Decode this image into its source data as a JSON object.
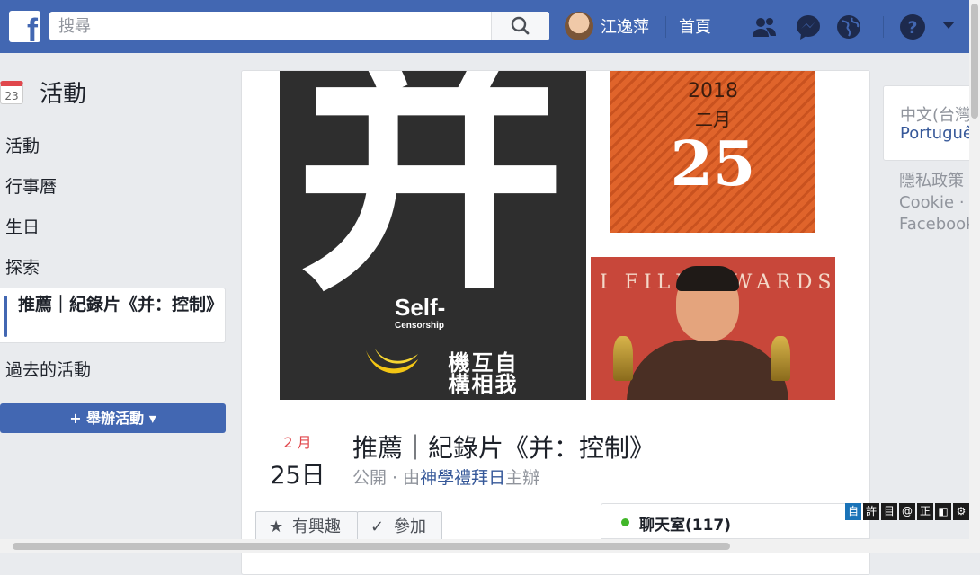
{
  "topbar": {
    "logo": "f",
    "search_placeholder": "搜尋",
    "username": "江逸萍",
    "home": "首頁",
    "icons": [
      "friends-icon",
      "messenger-icon",
      "notifications-globe-icon",
      "help-icon",
      "account-menu-caret-icon"
    ],
    "color": "#4267b2"
  },
  "nav": {
    "calendar_day": "23",
    "title": "活動",
    "items": [
      "活動",
      "行事曆",
      "生日",
      "探索"
    ],
    "active": "推薦｜紀錄片《并：控制》",
    "past": "過去的活動",
    "create_plus": "+",
    "create_label": "舉辦活動",
    "create_caret": "▾"
  },
  "cover": {
    "poster_char": "并",
    "poster_en_1": "Self-",
    "poster_en_2": "Censorship",
    "poster_v1": "自我",
    "poster_v2": "互相",
    "poster_v3": "機構",
    "poster_date_year": "2018",
    "poster_date_month": "二月",
    "poster_date_day": "25",
    "award_text": "I FILM AWARDS"
  },
  "event": {
    "month": "2 月",
    "day": "25日",
    "title": "推薦｜紀錄片《并：控制》",
    "visibility": "公開",
    "sep": " · 由",
    "host": "神學禮拜日",
    "host_suffix": "主辦",
    "interested_icon": "★",
    "interested": "有興趣",
    "going_icon": "✓",
    "going": "參加"
  },
  "chat": {
    "label": "聊天室(117)",
    "status_color": "#42b72a"
  },
  "right": {
    "lang_current": "中文(台灣)",
    "lang_alt": "Português",
    "links": [
      "隱私政策",
      "Cookie · 廣告",
      "Facebook"
    ]
  },
  "ime": {
    "keys": [
      "自",
      "許",
      "目",
      "@",
      "正",
      "◧",
      "⚙"
    ]
  }
}
